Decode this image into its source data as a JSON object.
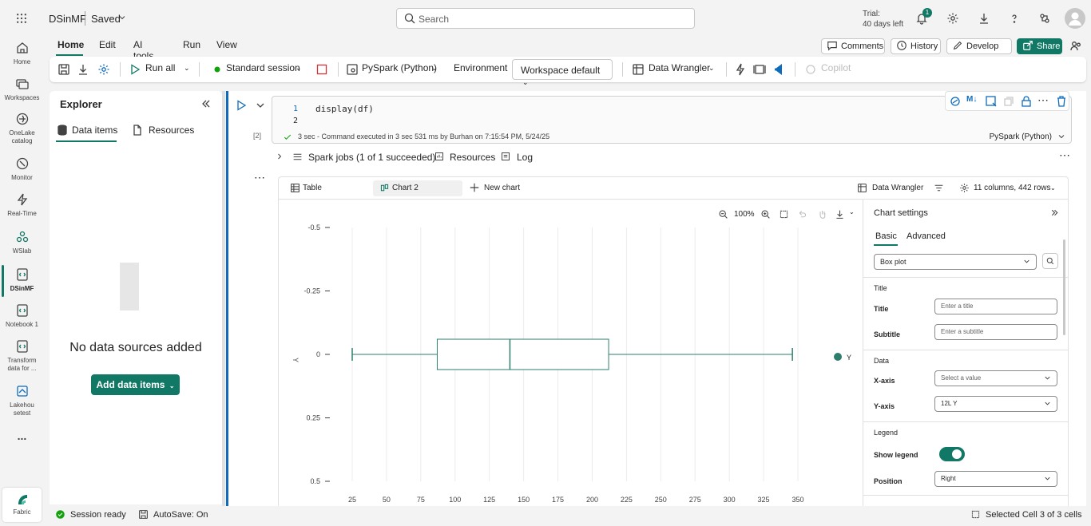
{
  "app": {
    "workspace_name": "DSinMF",
    "save_state": "Saved",
    "search_placeholder": "Search",
    "trial_line1": "Trial:",
    "trial_line2": "40 days left",
    "notification_count": "1"
  },
  "leftnav": {
    "items": [
      {
        "label": "Home",
        "icon": "home-icon"
      },
      {
        "label": "Workspaces",
        "icon": "workspaces-icon"
      },
      {
        "label": "OneLake catalog",
        "icon": "onelake-icon"
      },
      {
        "label": "Monitor",
        "icon": "monitor-icon"
      },
      {
        "label": "Real-Time",
        "icon": "realtime-icon"
      },
      {
        "label": "WSlab",
        "icon": "wslab-icon"
      },
      {
        "label": "DSinMF",
        "icon": "notebook-icon"
      },
      {
        "label": "Notebook 1",
        "icon": "notebook-icon"
      },
      {
        "label": "Transform data for ...",
        "icon": "notebook-icon"
      },
      {
        "label": "Lakehousetest",
        "icon": "lakehouse-icon"
      }
    ],
    "more_label": "...",
    "fabric_label": "Fabric"
  },
  "ribbon": {
    "tabs": [
      "Home",
      "Edit",
      "AI tools",
      "Run",
      "View"
    ],
    "active_tab": "Home",
    "comments": "Comments",
    "history": "History",
    "develop": "Develop",
    "share": "Share"
  },
  "toolbar": {
    "run_all": "Run all",
    "session": "Standard session",
    "language": "PySpark (Python)",
    "environment_label": "Environment",
    "environment_value": "Workspace default",
    "data_wrangler": "Data Wrangler",
    "copilot": "Copilot",
    "session_color": "#13a10e",
    "stop_color": "#d13438"
  },
  "explorer": {
    "title": "Explorer",
    "tab_data_items": "Data items",
    "tab_resources": "Resources",
    "empty_message": "No data sources added",
    "add_button": "Add data items"
  },
  "cell": {
    "line_numbers": [
      "1",
      "2"
    ],
    "code": "display(df)",
    "exec_count": "[2]",
    "status": "3 sec - Command executed in 3 sec 531 ms by Burhan on 7:15:54 PM, 5/24/25",
    "language": "PySpark (Python)"
  },
  "output": {
    "spark_jobs": "Spark jobs (1 of 1 succeeded)",
    "resources": "Resources",
    "log": "Log"
  },
  "chart_view": {
    "tab_table": "Table",
    "tab_chart": "Chart 2",
    "new_chart": "New chart",
    "data_wrangler": "Data Wrangler",
    "summary": "11 columns, 442 rows",
    "zoom": "100%"
  },
  "settings": {
    "title": "Chart settings",
    "tab_basic": "Basic",
    "tab_advanced": "Advanced",
    "chart_type": "Box plot",
    "section_title": "Title",
    "title_label": "Title",
    "title_placeholder": "Enter a title",
    "subtitle_label": "Subtitle",
    "subtitle_placeholder": "Enter a subtitle",
    "section_data": "Data",
    "xaxis_label": "X-axis",
    "xaxis_placeholder": "Select a value",
    "yaxis_label": "Y-axis",
    "yaxis_value": "12L Y",
    "section_legend": "Legend",
    "show_legend_label": "Show legend",
    "show_legend": true,
    "position_label": "Position",
    "position_value": "Right"
  },
  "chart_data": {
    "type": "box",
    "orientation": "horizontal",
    "series": [
      {
        "name": "Y",
        "min": 25,
        "q1": 87,
        "median": 140,
        "q3": 212,
        "max": 346
      }
    ],
    "xlim": [
      25,
      350
    ],
    "x_ticks": [
      "25",
      "50",
      "75",
      "100",
      "125",
      "150",
      "175",
      "200",
      "225",
      "250",
      "275",
      "300",
      "325",
      "350"
    ],
    "y_ticks": [
      "-0.5",
      "-0.25",
      "0",
      "0.25",
      "0.5"
    ],
    "ylabel": "Y",
    "legend": "right",
    "grid": true,
    "color": "#2f7d6d"
  },
  "status": {
    "session": "Session ready",
    "autosave": "AutoSave: On",
    "selected": "Selected Cell 3 of 3 cells"
  }
}
